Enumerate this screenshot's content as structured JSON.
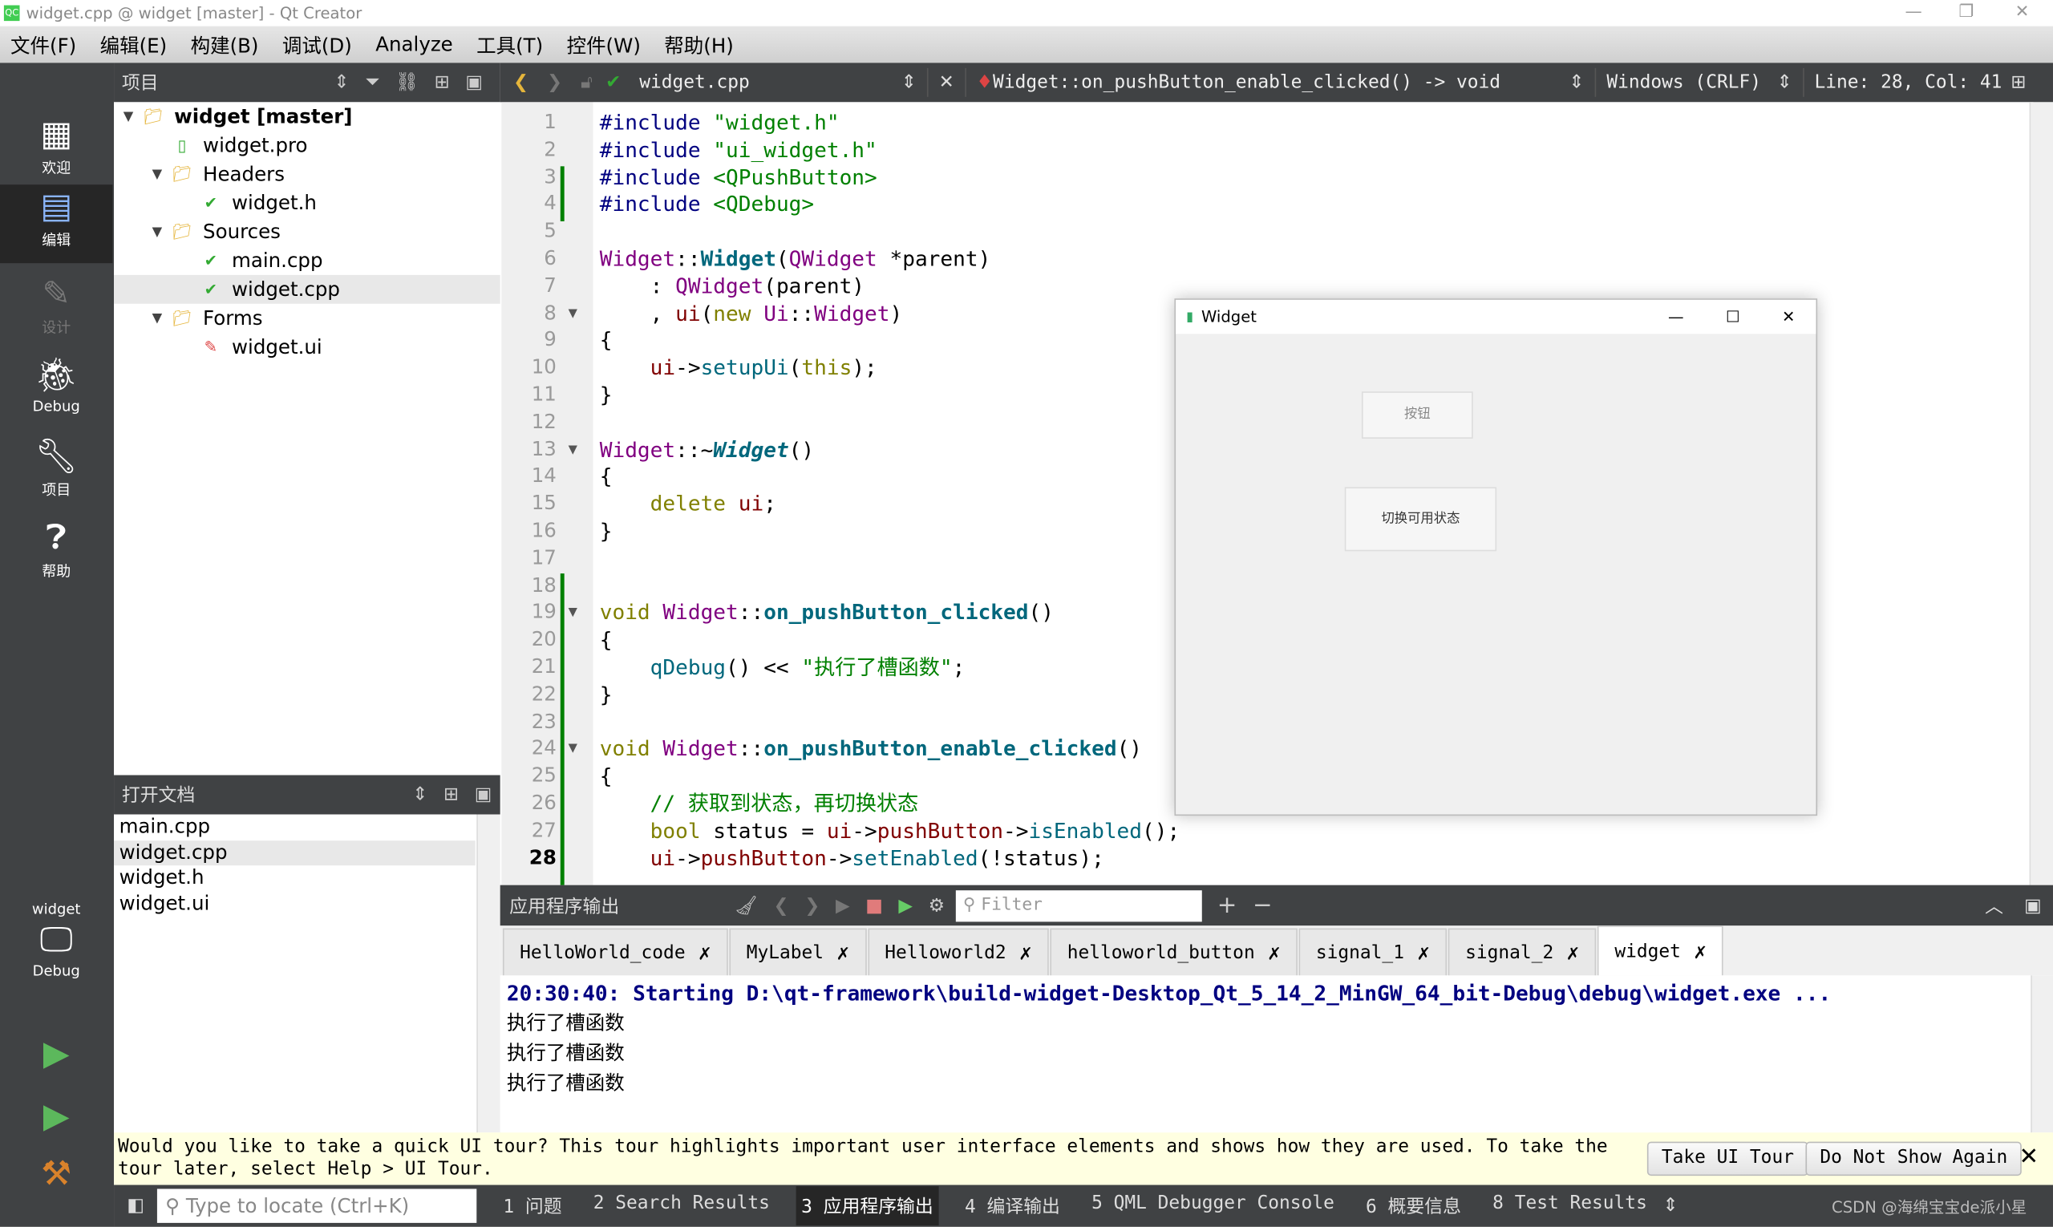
{
  "window": {
    "title": "widget.cpp @ widget [master] - Qt Creator",
    "app_icon": "QC"
  },
  "menu": [
    "文件(F)",
    "编辑(E)",
    "构建(B)",
    "调试(D)",
    "Analyze",
    "工具(T)",
    "控件(W)",
    "帮助(H)"
  ],
  "modes": [
    {
      "label": "欢迎",
      "icon": "grid-icon"
    },
    {
      "label": "编辑",
      "icon": "edit-icon"
    },
    {
      "label": "设计",
      "icon": "pen-icon"
    },
    {
      "label": "Debug",
      "icon": "bug-icon"
    },
    {
      "label": "项目",
      "icon": "wrench-icon"
    },
    {
      "label": "帮助",
      "icon": "help-icon"
    }
  ],
  "kit": {
    "project": "widget",
    "config": "Debug"
  },
  "project_panel": {
    "title": "项目",
    "tree": [
      {
        "label": "widget [master]",
        "level": 0,
        "expanded": true,
        "bold": true,
        "icon": "project-folder"
      },
      {
        "label": "widget.pro",
        "level": 1,
        "icon": "pro-file"
      },
      {
        "label": "Headers",
        "level": 1,
        "expanded": true,
        "icon": "folder"
      },
      {
        "label": "widget.h",
        "level": 2,
        "icon": "header-file"
      },
      {
        "label": "Sources",
        "level": 1,
        "expanded": true,
        "icon": "folder"
      },
      {
        "label": "main.cpp",
        "level": 2,
        "icon": "cpp-file"
      },
      {
        "label": "widget.cpp",
        "level": 2,
        "icon": "cpp-file",
        "selected": true
      },
      {
        "label": "Forms",
        "level": 1,
        "expanded": true,
        "icon": "folder"
      },
      {
        "label": "widget.ui",
        "level": 2,
        "icon": "ui-file"
      }
    ]
  },
  "open_docs": {
    "title": "打开文档",
    "items": [
      "main.cpp",
      "widget.cpp",
      "widget.h",
      "widget.ui"
    ],
    "selected": 1
  },
  "editor_toolbar": {
    "file": "widget.cpp",
    "symbol": "Widget::on_pushButton_enable_clicked() -> void",
    "line_ending": "Windows (CRLF)",
    "position": "Line: 28, Col: 41"
  },
  "editor": {
    "current_line": 28,
    "fold_lines": [
      8,
      13,
      19,
      24
    ],
    "lines": [
      [
        [
          "#include ",
          "pp"
        ],
        [
          "\"widget.h\"",
          "str"
        ]
      ],
      [
        [
          "#include ",
          "pp"
        ],
        [
          "\"ui_widget.h\"",
          "str"
        ]
      ],
      [
        [
          "#include ",
          "pp"
        ],
        [
          "<QPushButton>",
          "str"
        ]
      ],
      [
        [
          "#include ",
          "pp"
        ],
        [
          "<QDebug>",
          "str"
        ]
      ],
      [],
      [
        [
          "Widget",
          "ty"
        ],
        [
          "::",
          ""
        ],
        [
          "Widget",
          "fnb"
        ],
        [
          "(",
          ""
        ],
        [
          "QWidget",
          "ty"
        ],
        [
          " *parent)",
          ""
        ]
      ],
      [
        [
          "    : ",
          ""
        ],
        [
          "QWidget",
          "ty"
        ],
        [
          "(parent)",
          ""
        ]
      ],
      [
        [
          "    , ",
          ""
        ],
        [
          "ui",
          "mem"
        ],
        [
          "(",
          ""
        ],
        [
          "new",
          "kw"
        ],
        [
          " ",
          ""
        ],
        [
          "Ui",
          "ty"
        ],
        [
          "::",
          ""
        ],
        [
          "Widget",
          "ty"
        ],
        [
          ")",
          ""
        ]
      ],
      [
        [
          "{",
          ""
        ]
      ],
      [
        [
          "    ",
          ""
        ],
        [
          "ui",
          "mem"
        ],
        [
          "->",
          ""
        ],
        [
          "setupUi",
          "fn"
        ],
        [
          "(",
          ""
        ],
        [
          "this",
          "kw"
        ],
        [
          ");",
          ""
        ]
      ],
      [
        [
          "}",
          ""
        ]
      ],
      [],
      [
        [
          "Widget",
          "ty"
        ],
        [
          "::~",
          ""
        ],
        [
          "Widget",
          "fni"
        ],
        [
          "()",
          ""
        ]
      ],
      [
        [
          "{",
          ""
        ]
      ],
      [
        [
          "    ",
          ""
        ],
        [
          "delete",
          "kw"
        ],
        [
          " ",
          ""
        ],
        [
          "ui",
          "mem"
        ],
        [
          ";",
          ""
        ]
      ],
      [
        [
          "}",
          ""
        ]
      ],
      [],
      [],
      [
        [
          "void",
          "kw"
        ],
        [
          " ",
          ""
        ],
        [
          "Widget",
          "ty"
        ],
        [
          "::",
          ""
        ],
        [
          "on_pushButton_clicked",
          "fnb"
        ],
        [
          "()",
          ""
        ]
      ],
      [
        [
          "{",
          ""
        ]
      ],
      [
        [
          "    ",
          ""
        ],
        [
          "qDebug",
          "fn"
        ],
        [
          "() << ",
          ""
        ],
        [
          "\"执行了槽函数\"",
          "str"
        ],
        [
          ";",
          ""
        ]
      ],
      [
        [
          "}",
          ""
        ]
      ],
      [],
      [
        [
          "void",
          "kw"
        ],
        [
          " ",
          ""
        ],
        [
          "Widget",
          "ty"
        ],
        [
          "::",
          ""
        ],
        [
          "on_pushButton_enable_clicked",
          "fnb"
        ],
        [
          "()",
          ""
        ]
      ],
      [
        [
          "{",
          ""
        ]
      ],
      [
        [
          "    ",
          ""
        ],
        [
          "// 获取到状态，再切换状态",
          "cm"
        ]
      ],
      [
        [
          "    ",
          ""
        ],
        [
          "bool",
          "kw"
        ],
        [
          " status = ",
          ""
        ],
        [
          "ui",
          "mem"
        ],
        [
          "->",
          ""
        ],
        [
          "pushButton",
          "mem"
        ],
        [
          "->",
          ""
        ],
        [
          "isEnabled",
          "fn"
        ],
        [
          "();",
          ""
        ]
      ],
      [
        [
          "    ",
          ""
        ],
        [
          "ui",
          "mem"
        ],
        [
          "->",
          ""
        ],
        [
          "pushButton",
          "mem"
        ],
        [
          "->",
          ""
        ],
        [
          "setEnabled",
          "fn"
        ],
        [
          "(!status);",
          ""
        ]
      ]
    ]
  },
  "running_widget": {
    "title": "Widget",
    "button1": "按钮",
    "button2": "切换可用状态"
  },
  "output": {
    "title": "应用程序输出",
    "filter_placeholder": "Filter",
    "tabs": [
      "HelloWorld_code",
      "MyLabel",
      "Helloworld2",
      "helloworld_button",
      "signal_1",
      "signal_2",
      "widget"
    ],
    "active_tab": 6,
    "lines": [
      "20:30:40: Starting D:\\qt-framework\\build-widget-Desktop_Qt_5_14_2_MinGW_64_bit-Debug\\debug\\widget.exe ...",
      "执行了槽函数",
      "执行了槽函数",
      "执行了槽函数"
    ]
  },
  "tour": {
    "message": "Would you like to take a quick UI tour? This tour highlights important user interface elements and shows how they are used. To take the tour later, select Help > UI Tour.",
    "take": "Take UI Tour",
    "dont": "Do Not Show Again"
  },
  "statusbar": {
    "locate_placeholder": "Type to locate (Ctrl+K)",
    "items": [
      "1 问题",
      "2 Search Results",
      "3 应用程序输出",
      "4 编译输出",
      "5 QML Debugger Console",
      "6 概要信息",
      "8 Test Results"
    ],
    "active": 2,
    "watermark": "CSDN @海绵宝宝de派小星"
  }
}
